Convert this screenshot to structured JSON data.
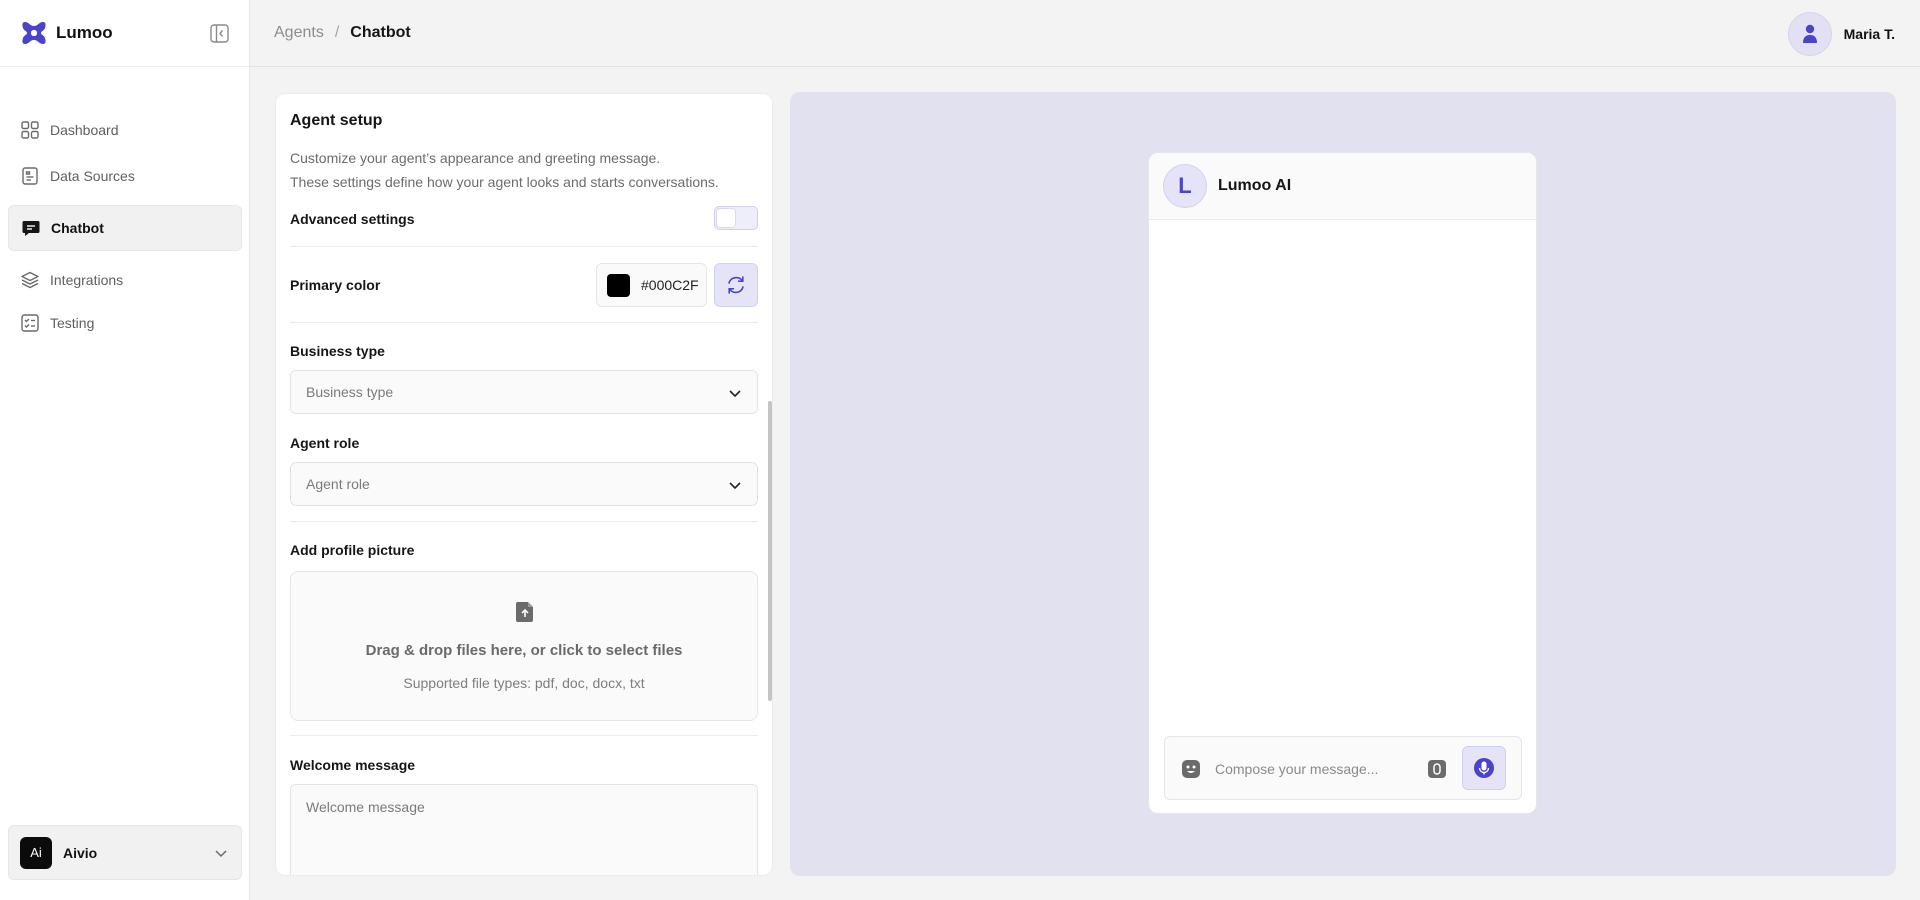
{
  "app": {
    "name": "Lumoo"
  },
  "sidebar": {
    "items": [
      {
        "label": "Dashboard"
      },
      {
        "label": "Data Sources"
      },
      {
        "label": "Chatbot"
      },
      {
        "label": "Integrations"
      },
      {
        "label": "Testing"
      }
    ],
    "active_item": "Chatbot",
    "workspace": {
      "badge": "Ai",
      "name": "Aivio"
    }
  },
  "header": {
    "breadcrumb": [
      {
        "label": "Agents"
      },
      {
        "label": "Chatbot"
      }
    ],
    "separator": "/",
    "user_name": "Maria T."
  },
  "setup": {
    "title": "Agent setup",
    "description_line1": "Customize your agent’s appearance and greeting message.",
    "description_line2": "These settings define how your agent looks and starts conversations.",
    "advanced_label": "Advanced settings",
    "advanced_enabled": false,
    "primary_color_label": "Primary color",
    "primary_color_value": "#000C2F",
    "business_type_label": "Business type",
    "business_type_placeholder": "Business type",
    "agent_role_label": "Agent role",
    "agent_role_placeholder": "Agent role",
    "profile_picture_label": "Add profile picture",
    "dropzone_text": "Drag & drop files here, or click to select files",
    "dropzone_subtext": "Supported file types: pdf, doc, docx, txt",
    "welcome_label": "Welcome message",
    "welcome_placeholder": "Welcome message"
  },
  "preview": {
    "avatar_letter": "L",
    "agent_name": "Lumoo AI",
    "compose_placeholder": "Compose your message..."
  },
  "colors": {
    "accent": "#4a44c9",
    "accent_soft": "#e5e4f7",
    "preview_bg": "#e2e1f0"
  }
}
